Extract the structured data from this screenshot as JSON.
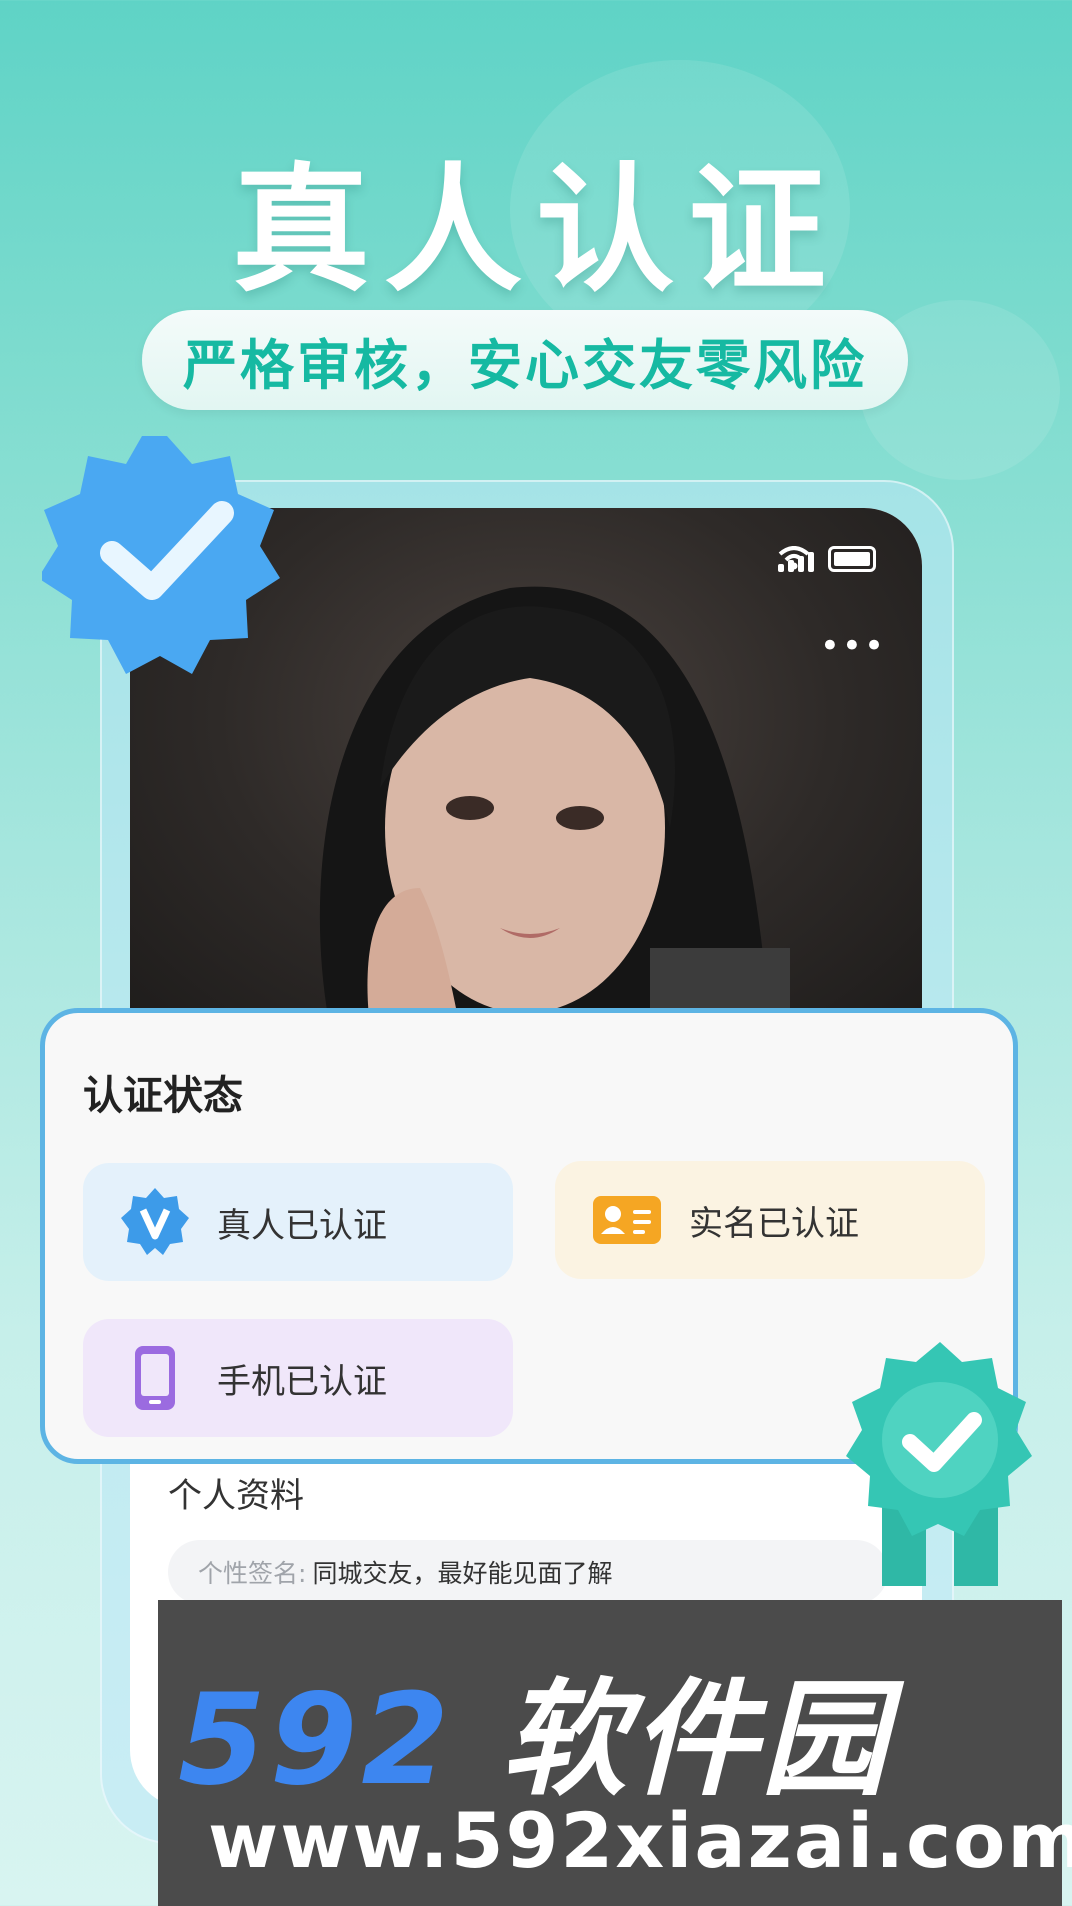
{
  "hero": {
    "title": "真人认证",
    "subtitle": "严格审核，安心交友零风险"
  },
  "profile_screen": {
    "more_label": "•••",
    "status_card": {
      "title": "认证状态",
      "items": [
        {
          "label": "真人已认证",
          "icon": "verified-v-badge-icon",
          "color": "#3d9be9"
        },
        {
          "label": "实名已认证",
          "icon": "id-card-icon",
          "color": "#f5a623"
        },
        {
          "label": "手机已认证",
          "icon": "phone-icon",
          "color": "#9b6be0"
        }
      ]
    },
    "profile_section_title": "个人资料",
    "signature": {
      "key": "个性签名:",
      "value": "同城交友，最好能见面了解"
    }
  },
  "watermark": {
    "brand_number": "592",
    "brand_name": "软件园",
    "url": "www.592xiazai.com"
  },
  "colors": {
    "background_top": "#5fd3c6",
    "subtitle_text": "#16b9a2",
    "card_border": "#5db4e4",
    "badge_blue": "#4aa8f2",
    "badge_teal": "#35c6b4"
  }
}
